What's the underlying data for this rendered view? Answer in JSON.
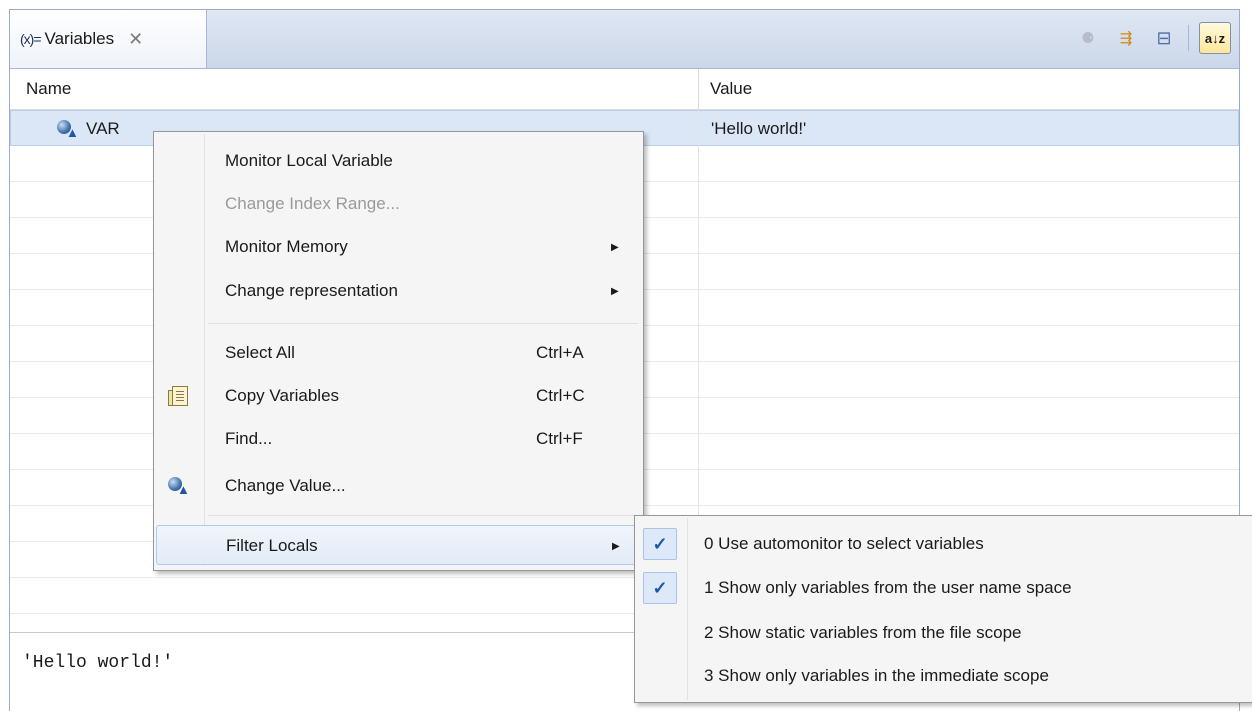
{
  "view": {
    "tab_icon": "(x)=",
    "tab_title": "Variables",
    "tab_close": "✕",
    "toolbar": [
      {
        "name": "show-type-names-icon",
        "glyph": "⚈",
        "disabled": true
      },
      {
        "name": "layout-icon",
        "glyph": "⇶",
        "disabled": false
      },
      {
        "name": "collapse-all-icon",
        "glyph": "⊟",
        "disabled": false
      },
      {
        "name": "sort-icon",
        "glyph": "a↓z",
        "disabled": false
      }
    ]
  },
  "columns": {
    "name": "Name",
    "value": "Value"
  },
  "variables": [
    {
      "name": "VAR",
      "value": "'Hello world!'"
    }
  ],
  "detail_text": "'Hello world!'",
  "context_menu": {
    "items": [
      {
        "label": "Monitor Local Variable",
        "shortcut": "",
        "submenu": false,
        "disabled": false,
        "icon": ""
      },
      {
        "label": "Change Index Range...",
        "shortcut": "",
        "submenu": false,
        "disabled": true,
        "icon": ""
      },
      {
        "label": "Monitor Memory",
        "shortcut": "",
        "submenu": true,
        "disabled": false,
        "icon": ""
      },
      {
        "label": "Change representation",
        "shortcut": "",
        "submenu": true,
        "disabled": false,
        "icon": ""
      },
      {
        "label": "Select All",
        "shortcut": "Ctrl+A",
        "submenu": false,
        "disabled": false,
        "icon": ""
      },
      {
        "label": "Copy Variables",
        "shortcut": "Ctrl+C",
        "submenu": false,
        "disabled": false,
        "icon": "copy-icon"
      },
      {
        "label": "Find...",
        "shortcut": "Ctrl+F",
        "submenu": false,
        "disabled": false,
        "icon": ""
      },
      {
        "label": "Change Value...",
        "shortcut": "",
        "submenu": false,
        "disabled": false,
        "icon": "variable-icon"
      },
      {
        "label": "Filter Locals",
        "shortcut": "",
        "submenu": true,
        "disabled": false,
        "icon": ""
      }
    ]
  },
  "filter_submenu": {
    "items": [
      {
        "label": "0 Use automonitor to select variables",
        "checked": true
      },
      {
        "label": "1 Show only variables from the user name space",
        "checked": true
      },
      {
        "label": "2 Show static variables from the file scope",
        "checked": false
      },
      {
        "label": "3 Show only variables in the immediate scope",
        "checked": false
      }
    ],
    "check_glyph": "✓"
  }
}
